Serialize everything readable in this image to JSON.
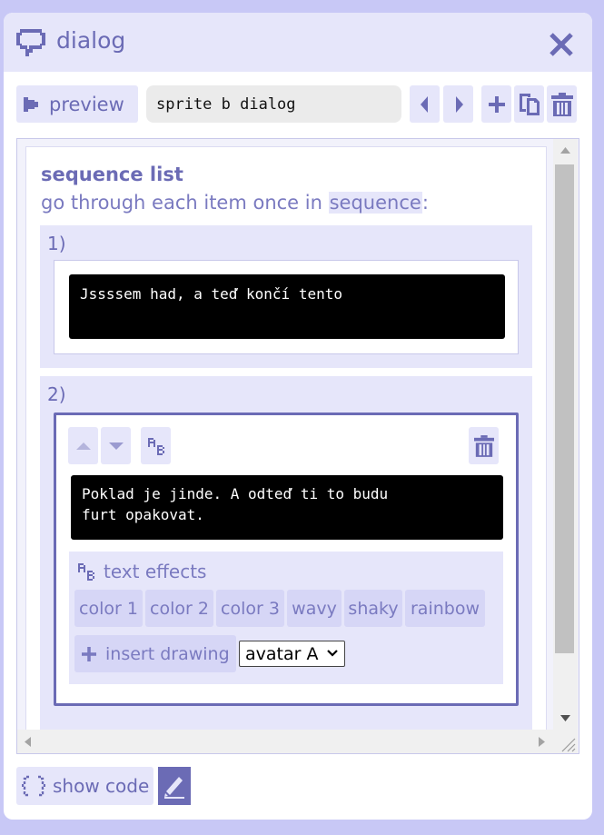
{
  "window": {
    "title": "dialog",
    "close_icon": "close-icon",
    "title_icon": "speech-bubble-icon"
  },
  "toolbar": {
    "preview_label": "preview",
    "name_value": "sprite b dialog",
    "icons": [
      "previous-icon",
      "next-icon",
      "add-icon",
      "copy-icon",
      "trash-icon"
    ]
  },
  "sequence": {
    "title": "sequence list",
    "desc_prefix": "go through each item once in ",
    "desc_chip": "sequence",
    "desc_suffix": ":",
    "items": [
      {
        "number": "1)",
        "text": "Jssssem had, a teď končí tento"
      },
      {
        "number": "2)",
        "text": "Poklad je jinde. A odteď ti to budu\nfurt opakovat."
      }
    ]
  },
  "effects": {
    "title": "text effects",
    "buttons": [
      "color 1",
      "color 2",
      "color 3",
      "wavy",
      "shaky",
      "rainbow"
    ],
    "insert_label": "insert drawing",
    "avatar_selected": "avatar A"
  },
  "footer": {
    "show_code_label": "show code"
  },
  "colors": {
    "accent": "#6b6bb5",
    "light": "#e6e6fa",
    "background": "#c8c8f6"
  }
}
